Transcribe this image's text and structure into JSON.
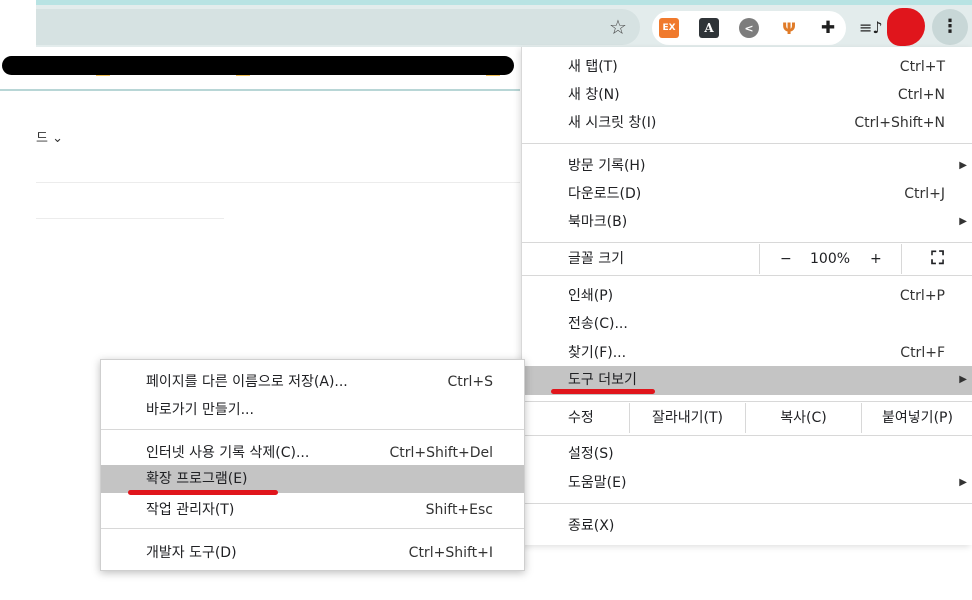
{
  "toolbar": {
    "star_icon": "star-icon",
    "extensions": [
      {
        "name": "ex-extension-icon",
        "text": "EX"
      },
      {
        "name": "font-a-extension-icon",
        "text": "A"
      },
      {
        "name": "share-extension-icon",
        "text": "<"
      },
      {
        "name": "plant-extension-icon",
        "text": "Ψ"
      },
      {
        "name": "puzzle-extensions-icon",
        "text": "✚"
      }
    ],
    "kebab": "⋮"
  },
  "page": {
    "fragment": "드 ⌄"
  },
  "main_menu": {
    "new_tab": {
      "label": "새 탭(T)",
      "shortcut": "Ctrl+T"
    },
    "new_window": {
      "label": "새 창(N)",
      "shortcut": "Ctrl+N"
    },
    "incognito": {
      "label": "새 시크릿 창(I)",
      "shortcut": "Ctrl+Shift+N"
    },
    "history": {
      "label": "방문 기록(H)"
    },
    "downloads": {
      "label": "다운로드(D)",
      "shortcut": "Ctrl+J"
    },
    "bookmarks": {
      "label": "북마크(B)"
    },
    "zoom": {
      "label": "글꼴 크기",
      "minus": "−",
      "value": "100%",
      "plus": "+"
    },
    "print": {
      "label": "인쇄(P)",
      "shortcut": "Ctrl+P"
    },
    "cast": {
      "label": "전송(C)..."
    },
    "find": {
      "label": "찾기(F)...",
      "shortcut": "Ctrl+F"
    },
    "more_tools": {
      "label": "도구 더보기"
    },
    "edit": {
      "label": "수정",
      "cut": "잘라내기(T)",
      "copy": "복사(C)",
      "paste": "붙여넣기(P)"
    },
    "settings": {
      "label": "설정(S)"
    },
    "help": {
      "label": "도움말(E)"
    },
    "exit": {
      "label": "종료(X)"
    }
  },
  "sub_menu": {
    "save_page": {
      "label": "페이지를 다른 이름으로 저장(A)...",
      "shortcut": "Ctrl+S"
    },
    "create_shortcut": {
      "label": "바로가기 만들기..."
    },
    "clear_data": {
      "label": "인터넷 사용 기록 삭제(C)...",
      "shortcut": "Ctrl+Shift+Del"
    },
    "extensions": {
      "label": "확장 프로그램(E)"
    },
    "task_manager": {
      "label": "작업 관리자(T)",
      "shortcut": "Shift+Esc"
    },
    "dev_tools": {
      "label": "개발자 도구(D)",
      "shortcut": "Ctrl+Shift+I"
    }
  },
  "colors": {
    "annotation_red": "#e0151c",
    "highlight": "#c4c4c4",
    "chrome_teal": "#b8e3e3"
  }
}
